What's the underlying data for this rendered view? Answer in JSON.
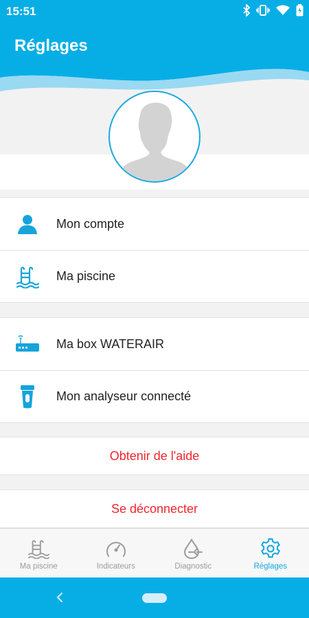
{
  "status_bar": {
    "time": "15:51",
    "icons": [
      "bluetooth-icon",
      "vibrate-icon",
      "wifi-icon",
      "battery-icon"
    ]
  },
  "header": {
    "title": "Réglages"
  },
  "profile": {
    "avatar_icon": "person-silhouette-icon"
  },
  "menu_groups": [
    {
      "items": [
        {
          "label": "Mon compte",
          "icon": "user-icon"
        },
        {
          "label": "Ma piscine",
          "icon": "pool-ladder-icon"
        }
      ]
    },
    {
      "items": [
        {
          "label": "Ma box WATERAIR",
          "icon": "router-box-icon"
        },
        {
          "label": "Mon analyseur connecté",
          "icon": "analyzer-probe-icon"
        }
      ]
    }
  ],
  "actions": {
    "help_label": "Obtenir de l'aide",
    "logout_label": "Se déconnecter"
  },
  "bottom_nav": {
    "items": [
      {
        "label": "Ma piscine",
        "icon": "pool-ladder-icon",
        "active": false
      },
      {
        "label": "Indicateurs",
        "icon": "gauge-icon",
        "active": false
      },
      {
        "label": "Diagnostic",
        "icon": "water-drop-icon",
        "active": false
      },
      {
        "label": "Réglages",
        "icon": "gear-icon",
        "active": true
      }
    ]
  },
  "colors": {
    "brand_blue": "#07aee6",
    "accent_blue": "#12a7e0",
    "action_red": "#f0262e",
    "inactive_grey": "#9b9b9b"
  }
}
